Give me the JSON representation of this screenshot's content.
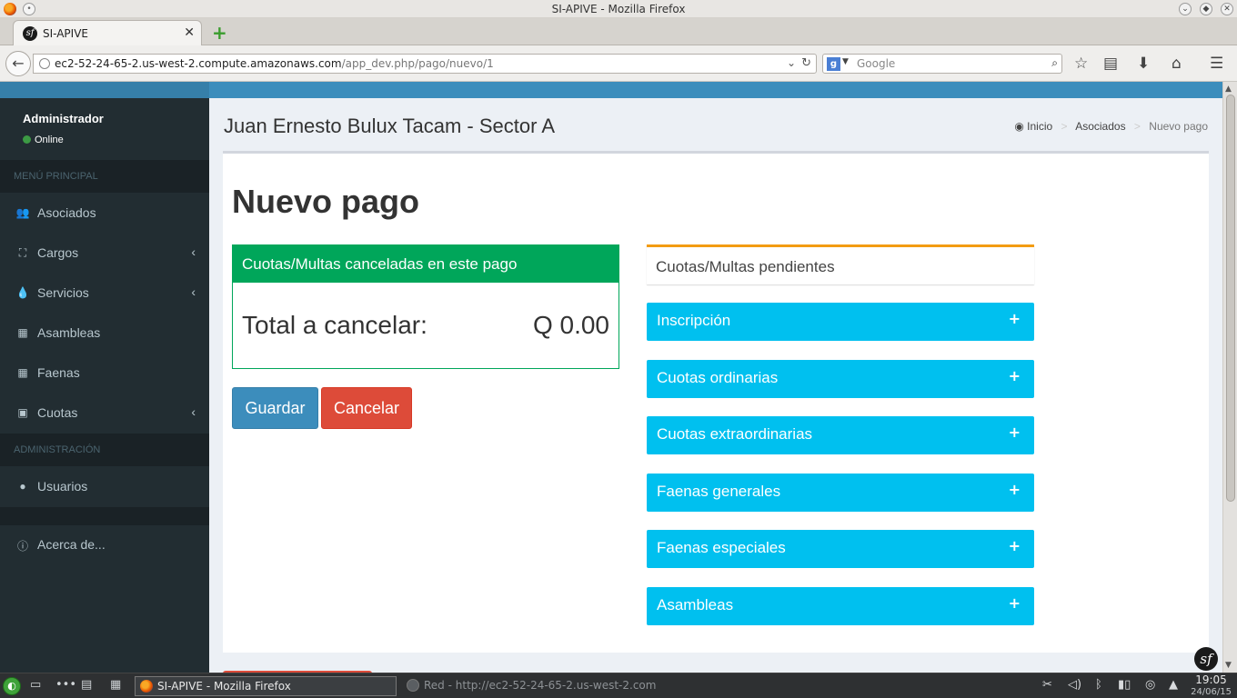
{
  "window": {
    "title": "SI-APIVE - Mozilla Firefox"
  },
  "browser": {
    "tab_label": "SI-APIVE",
    "url_host": "ec2-52-24-65-2.us-west-2.compute.amazonaws.com",
    "url_path": "/app_dev.php/pago/nuevo/1",
    "search_placeholder": "Google"
  },
  "sidebar": {
    "user_name": "Administrador",
    "status": "Online",
    "section_main": "MENÚ PRINCIPAL",
    "section_admin": "ADMINISTRACIÓN",
    "items": [
      {
        "label": "Asociados",
        "icon": "users-icon",
        "has_submenu": false
      },
      {
        "label": "Cargos",
        "icon": "sitemap-icon",
        "has_submenu": true
      },
      {
        "label": "Servicios",
        "icon": "tint-icon",
        "has_submenu": true
      },
      {
        "label": "Asambleas",
        "icon": "calendar-icon",
        "has_submenu": false
      },
      {
        "label": "Faenas",
        "icon": "calendar-icon",
        "has_submenu": false
      },
      {
        "label": "Cuotas",
        "icon": "money-icon",
        "has_submenu": true
      }
    ],
    "admin_items": [
      {
        "label": "Usuarios",
        "icon": "user-icon"
      }
    ],
    "about": "Acerca de..."
  },
  "header": {
    "title": "Juan Ernesto Bulux Tacam - Sector A",
    "breadcrumb": {
      "home": "Inicio",
      "section": "Asociados",
      "current": "Nuevo pago"
    }
  },
  "main": {
    "heading": "Nuevo pago",
    "paid_box": {
      "title": "Cuotas/Multas canceladas en este pago",
      "total_label": "Total a cancelar:",
      "total_value": "Q 0.00"
    },
    "buttons": {
      "save": "Guardar",
      "cancel": "Cancelar"
    },
    "pending": {
      "title": "Cuotas/Multas pendientes",
      "groups": [
        "Inscripción",
        "Cuotas ordinarias",
        "Cuotas extraordinarias",
        "Faenas generales",
        "Faenas especiales",
        "Asambleas"
      ]
    }
  },
  "taskbar": {
    "active_task": "SI-APIVE - Mozilla Firefox",
    "inactive_task": "Red - http://ec2-52-24-65-2.us-west-2.com",
    "time": "19:05",
    "date": "24/06/15"
  },
  "colors": {
    "primary": "#3c8dbc",
    "success": "#00a65a",
    "danger": "#dd4b39",
    "info": "#00c0ef",
    "warning": "#f39c12",
    "sidebar_bg": "#222d32"
  }
}
